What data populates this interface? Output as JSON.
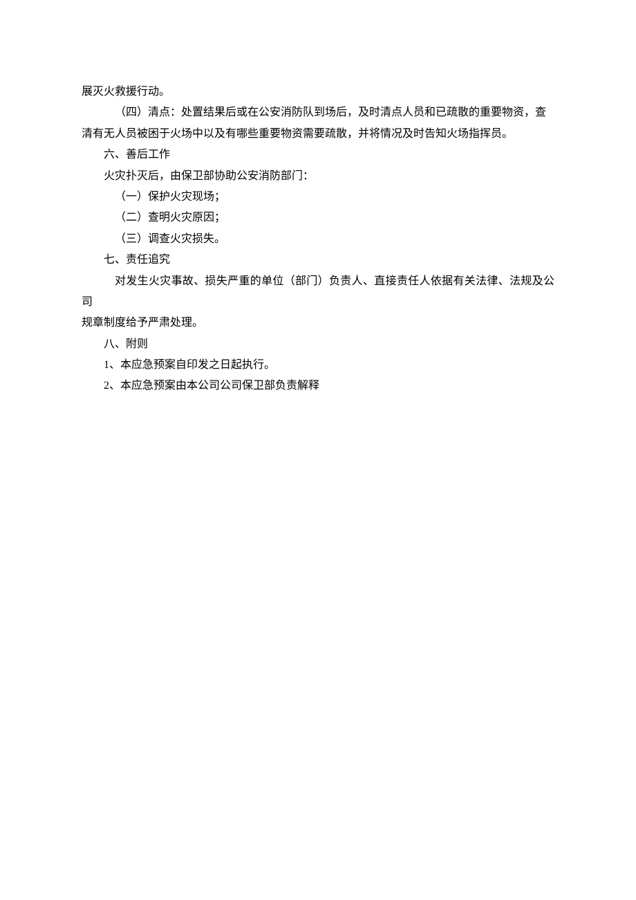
{
  "doc": {
    "lines": [
      {
        "cls": "cont-line",
        "text": "展灭火救援行动。"
      },
      {
        "cls": "indent-2",
        "text": "（四）清点：处置结果后或在公安消防队到场后，及时清点人员和已疏散的重要物资，查"
      },
      {
        "cls": "cont-line",
        "text": "清有无人员被困于火场中以及有哪些重要物资需要疏散，并将情况及时告知火场指挥员。"
      },
      {
        "cls": "indent-1",
        "text": "六、善后工作"
      },
      {
        "cls": "indent-1",
        "text": "火灾扑灭后，由保卫部协助公安消防部门："
      },
      {
        "cls": "indent-2",
        "text": "（一）保护火灾现场；"
      },
      {
        "cls": "indent-2",
        "text": "（二）查明火灾原因；"
      },
      {
        "cls": "indent-2",
        "text": "（三）调查火灾损失。"
      },
      {
        "cls": "indent-1",
        "text": "七、责任追究"
      },
      {
        "cls": "indent-2",
        "text": "对发生火灾事故、损失严重的单位（部门）负责人、直接责任人依据有关法律、法规及公司"
      },
      {
        "cls": "cont-line",
        "text": "规章制度给予严肃处理。"
      },
      {
        "cls": "indent-1",
        "text": "八、附则"
      },
      {
        "cls": "indent-1",
        "text": "1、本应急预案自印发之日起执行。"
      },
      {
        "cls": "indent-1",
        "text": "2、本应急预案由本公司公司保卫部负责解释"
      }
    ]
  }
}
